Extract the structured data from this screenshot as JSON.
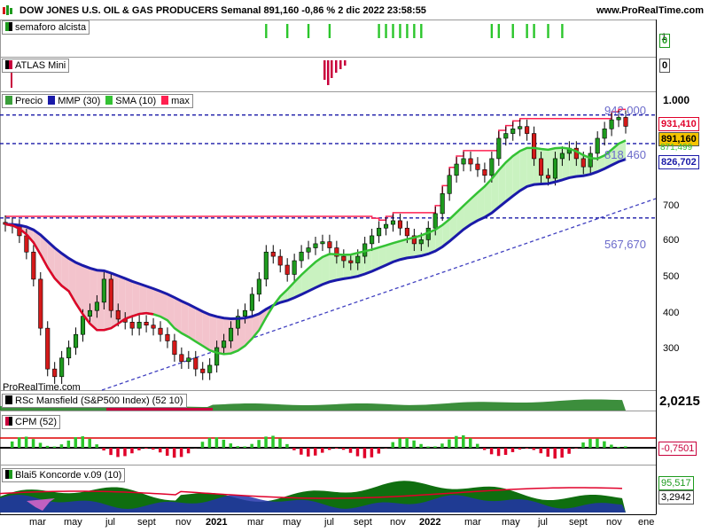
{
  "header": {
    "title": "DOW JONES U.S. OIL & GAS PRODUCERS Semanal 891,160 -0,86 % 2 dic 2022 23:58:55",
    "site": "www.ProRealTime.com"
  },
  "watermark": "ProRealTime.com",
  "panels": {
    "semaforo": {
      "label": "semaforo alcista",
      "axis_top": "1",
      "value": "0"
    },
    "atlas": {
      "label": "ATLAS Mini",
      "value": "0"
    },
    "price": {
      "legend": [
        "Precio",
        "MMP (30)",
        "SMA (10)",
        "max"
      ],
      "levels": [
        {
          "label": "942,000",
          "value": 942
        },
        {
          "label": "818,460",
          "value": 818.46
        },
        {
          "label": "567,670",
          "value": 567.67
        }
      ],
      "axis_ticks": [
        {
          "label": "1.000",
          "value": 1000
        },
        {
          "label": "700",
          "value": 700
        },
        {
          "label": "600",
          "value": 600
        },
        {
          "label": "500",
          "value": 500
        },
        {
          "label": "400",
          "value": 400
        },
        {
          "label": "300",
          "value": 300
        }
      ],
      "badges": [
        {
          "label": "931,410",
          "color": "#e0002a",
          "bg": "#ffffff"
        },
        {
          "label": "891,160",
          "color": "#000000",
          "bg": "#f5c400"
        },
        {
          "label": "871,499",
          "color": "#34c234",
          "bg": "#ffffff"
        },
        {
          "label": "826,702",
          "color": "#1a1aa8",
          "bg": "#ffffff"
        }
      ]
    },
    "rsc": {
      "label": "RSc Mansfield (S&P500 Index) (52 10)",
      "value": "2,0215"
    },
    "cpm": {
      "label": "CPM (52)",
      "value": "-0,7501"
    },
    "koncorde": {
      "label": "Blai5 Koncorde v.09 (10)",
      "values": [
        "95,517",
        "3,2942"
      ]
    }
  },
  "x_axis": [
    {
      "label": "mar",
      "bold": false
    },
    {
      "label": "may",
      "bold": false
    },
    {
      "label": "jul",
      "bold": false
    },
    {
      "label": "sept",
      "bold": false
    },
    {
      "label": "nov",
      "bold": false
    },
    {
      "label": "2021",
      "bold": true
    },
    {
      "label": "mar",
      "bold": false
    },
    {
      "label": "may",
      "bold": false
    },
    {
      "label": "jul",
      "bold": false
    },
    {
      "label": "sept",
      "bold": false
    },
    {
      "label": "nov",
      "bold": false
    },
    {
      "label": "2022",
      "bold": true
    },
    {
      "label": "mar",
      "bold": false
    },
    {
      "label": "may",
      "bold": false
    },
    {
      "label": "jul",
      "bold": false
    },
    {
      "label": "sept",
      "bold": false
    },
    {
      "label": "nov",
      "bold": false
    },
    {
      "label": "ene",
      "bold": false
    }
  ],
  "colors": {
    "candle_up": "#1e9a1e",
    "candle_down": "#d41919",
    "wick": "#000000",
    "mmp": "#1a1aa8",
    "sma": "#34c234",
    "max": "#ff2050",
    "level": "#1a1aa8",
    "trend": "#4040c0"
  },
  "chart_data": {
    "type": "candlestick",
    "interval": "weekly",
    "start_week": "2020-01-27",
    "close_approx": [
      550,
      545,
      520,
      480,
      420,
      330,
      270,
      260,
      285,
      300,
      320,
      350,
      360,
      375,
      420,
      360,
      345,
      340,
      330,
      340,
      335,
      330,
      320,
      310,
      290,
      280,
      285,
      270,
      265,
      275,
      300,
      310,
      330,
      350,
      360,
      390,
      420,
      480,
      470,
      450,
      430,
      460,
      480,
      490,
      500,
      505,
      490,
      470,
      460,
      455,
      470,
      500,
      520,
      540,
      550,
      560,
      540,
      520,
      500,
      510,
      540,
      580,
      640,
      700,
      740,
      760,
      740,
      720,
      700,
      760,
      840,
      860,
      880,
      890,
      860,
      760,
      700,
      690,
      760,
      780,
      800,
      760,
      730,
      780,
      840,
      880,
      920,
      931,
      891
    ],
    "levels": [
      942.0,
      818.46,
      567.67
    ]
  }
}
